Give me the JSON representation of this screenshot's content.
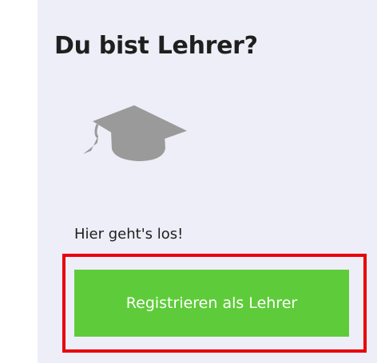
{
  "card": {
    "title": "Du bist Lehrer?",
    "icon": "graduation-cap-icon",
    "subtext": "Hier geht's los!",
    "register_button_label": "Registrieren als Lehrer"
  },
  "colors": {
    "card_background": "#eeeef8",
    "button_green": "#5ecc3a",
    "highlight_red": "#e8000d",
    "icon_gray": "#9a9a9a",
    "title_text": "#1f1f1f"
  }
}
